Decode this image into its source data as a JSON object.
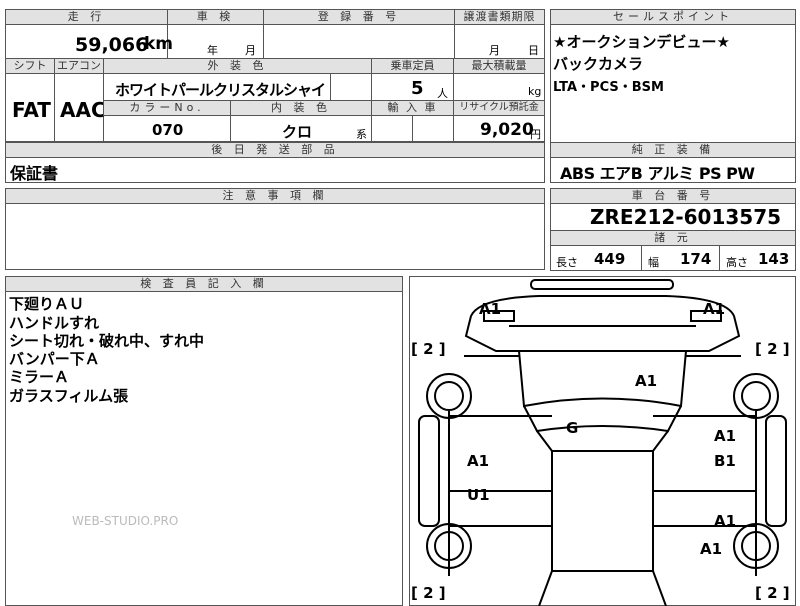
{
  "top": {
    "mileage_label": "走 行",
    "mileage_value": "59,066",
    "mileage_unit": "km",
    "inspection_label": "車 検",
    "inspection_year_unit": "年",
    "inspection_month_unit": "月",
    "registration_label": "登 録 番 号",
    "transfer_label": "譲渡書類期限",
    "transfer_month_unit": "月",
    "transfer_day_unit": "日"
  },
  "spec": {
    "shift_label": "シフト",
    "shift_value": "FAT",
    "ac_label": "エアコン",
    "ac_value": "AAC",
    "exterior_label": "外 装 色",
    "exterior_value": "ホワイトパールクリスタルシャイ",
    "capacity_label": "乗車定員",
    "capacity_value": "5",
    "capacity_unit": "人",
    "load_label": "最大積載量",
    "load_unit": "kg",
    "color_no_label": "カラーNo.",
    "color_no_value": "070",
    "interior_label": "内 装 色",
    "interior_value": "クロ",
    "interior_unit": "系",
    "import_label": "輸 入 車",
    "recycle_label": "リサイクル預託金",
    "recycle_value": "9,020",
    "recycle_unit": "円"
  },
  "later": {
    "label": "後 日 発 送 部 品",
    "value": "保証書"
  },
  "notes": {
    "label": "注 意 事 項 欄"
  },
  "sales": {
    "label": "セールスポイント",
    "lines": [
      "★オークションデビュー★",
      "バックカメラ",
      "LTA・PCS・BSM"
    ]
  },
  "equipment": {
    "label": "純 正 装 備",
    "value": "ABS エアB アルミ PS PW"
  },
  "chassis": {
    "label": "車 台 番 号",
    "value": "ZRE212-6013575"
  },
  "dims": {
    "label": "諸 元",
    "length_label": "長さ",
    "length_value": "449",
    "width_label": "幅",
    "width_value": "174",
    "height_label": "高さ",
    "height_value": "143"
  },
  "inspector": {
    "label": "検 査 員 記 入 欄",
    "lines": [
      "下廻りＡＵ",
      "ハンドルすれ",
      "シート切れ・破れ中、すれ中",
      "バンパー下Ａ",
      "ミラーＡ",
      "ガラスフィルム張"
    ],
    "watermark": "WEB-STUDIO.PRO"
  },
  "diagram": {
    "marks": {
      "front_left": "A1",
      "front_right": "A1",
      "hood": "A1",
      "roof": "G",
      "left_front_door": "A1",
      "left_rear_door": "U1",
      "right_front_top": "A1",
      "right_front_door": "B1",
      "right_rear_door": "A1",
      "right_rear": "A1"
    },
    "tires": {
      "front_left": "[ 2 ]",
      "front_right": "[ 2 ]",
      "rear_left": "[ 2 ]",
      "rear_right": "[ 2 ]"
    }
  }
}
